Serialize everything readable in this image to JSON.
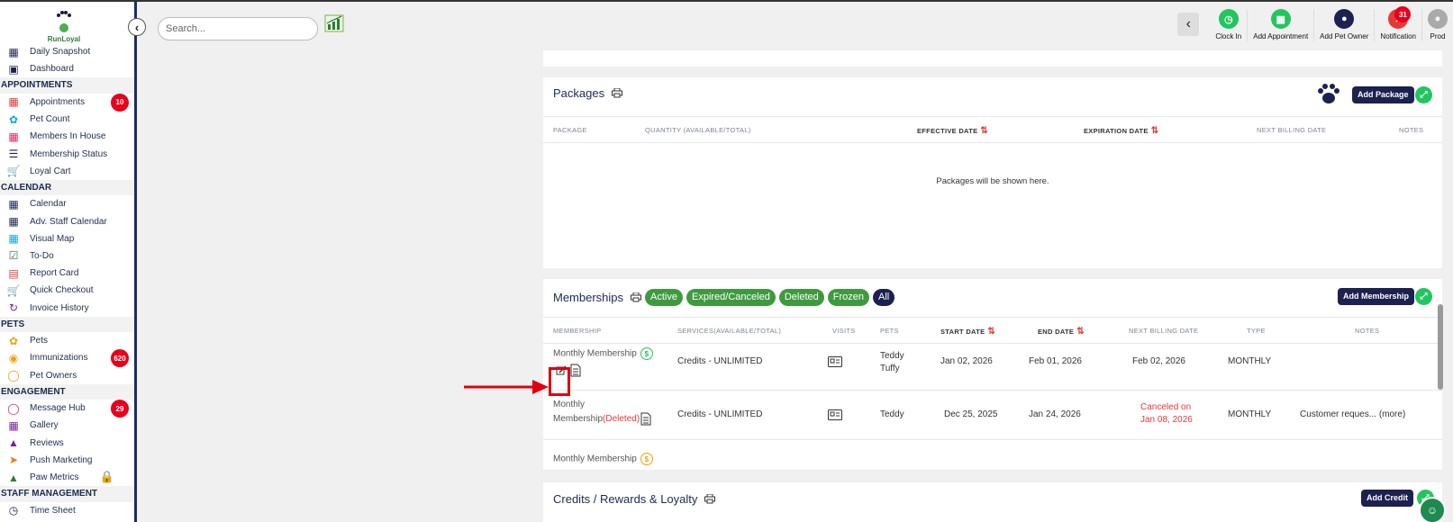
{
  "brand": {
    "name": "RunLoyal"
  },
  "search": {
    "placeholder": "Search..."
  },
  "sidebar": {
    "items_top": [
      {
        "label": "Daily Snapshot",
        "icon": "today-icon"
      },
      {
        "label": "Dashboard",
        "icon": "dashboard-icon"
      }
    ],
    "sections": [
      {
        "title": "APPOINTMENTS",
        "items": [
          {
            "label": "Appointments",
            "icon": "appointments-icon",
            "badge": "10"
          },
          {
            "label": "Pet Count",
            "icon": "pet-count-icon"
          },
          {
            "label": "Members In House",
            "icon": "house-icon"
          },
          {
            "label": "Membership Status",
            "icon": "status-icon"
          },
          {
            "label": "Loyal Cart",
            "icon": "cart-icon"
          }
        ]
      },
      {
        "title": "CALENDAR",
        "items": [
          {
            "label": "Calendar",
            "icon": "calendar-icon"
          },
          {
            "label": "Adv. Staff Calendar",
            "icon": "staff-calendar-icon"
          },
          {
            "label": "Visual Map",
            "icon": "map-icon"
          },
          {
            "label": "To-Do",
            "icon": "todo-icon"
          },
          {
            "label": "Report Card",
            "icon": "report-card-icon"
          },
          {
            "label": "Quick Checkout",
            "icon": "checkout-icon"
          },
          {
            "label": "Invoice History",
            "icon": "invoice-icon"
          }
        ]
      },
      {
        "title": "PETS",
        "items": [
          {
            "label": "Pets",
            "icon": "paw-icon"
          },
          {
            "label": "Immunizations",
            "icon": "immunization-icon",
            "badge": "620"
          },
          {
            "label": "Pet Owners",
            "icon": "person-icon"
          }
        ]
      },
      {
        "title": "ENGAGEMENT",
        "items": [
          {
            "label": "Message Hub",
            "icon": "message-icon",
            "badge": "29"
          },
          {
            "label": "Gallery",
            "icon": "gallery-icon"
          },
          {
            "label": "Reviews",
            "icon": "thumbs-up-icon"
          },
          {
            "label": "Push Marketing",
            "icon": "rocket-icon"
          },
          {
            "label": "Paw Metrics",
            "icon": "metrics-icon",
            "locked": true
          }
        ]
      },
      {
        "title": "STAFF MANAGEMENT",
        "items": [
          {
            "label": "Time Sheet",
            "icon": "clock-icon"
          }
        ]
      }
    ]
  },
  "topbar": {
    "items": [
      {
        "label": "Clock In",
        "color": "#22c55e"
      },
      {
        "label": "Add Appointment",
        "color": "#22c55e"
      },
      {
        "label": "Add Pet Owner",
        "color": "#1c2150"
      },
      {
        "label": "Notification",
        "color": "#e53935",
        "badge": "31"
      },
      {
        "label": "Prod",
        "color": "#aaaaaa"
      }
    ]
  },
  "packages": {
    "title": "Packages",
    "add_button": "Add Package",
    "columns": [
      "PACKAGE",
      "QUANTITY (AVAILABLE/TOTAL)",
      "EFFECTIVE DATE",
      "EXPIRATION DATE",
      "NEXT BILLING DATE",
      "NOTES"
    ],
    "empty_message": "Packages will be shown here."
  },
  "memberships": {
    "title": "Memberships",
    "filters": [
      "Active",
      "Expired/Canceled",
      "Deleted",
      "Frozen",
      "All"
    ],
    "add_button": "Add Membership",
    "columns": [
      "MEMBERSHIP",
      "SERVICES(AVAILABLE/TOTAL)",
      "VISITS",
      "PETS",
      "START DATE",
      "END DATE",
      "NEXT BILLING DATE",
      "TYPE",
      "NOTES"
    ],
    "rows": [
      {
        "name": "Monthly Membership",
        "deleted_tag": "",
        "services": "Credits - UNLIMITED",
        "pets": [
          "Teddy",
          "Tuffy"
        ],
        "start": "Jan 02, 2026",
        "end": "Feb 01, 2026",
        "next_billing": "Feb 02, 2026",
        "type": "MONTHLY",
        "notes": ""
      },
      {
        "name_line1": "Monthly",
        "name_line2": "Membership",
        "deleted_tag": "(Deleted)",
        "services": "Credits - UNLIMITED",
        "pets": [
          "Teddy"
        ],
        "start": "Dec 25, 2025",
        "end": "Jan 24, 2026",
        "next_billing_line1": "Canceled on",
        "next_billing_line2": "Jan 08, 2026",
        "type": "MONTHLY",
        "notes": "Customer reques...",
        "more": "(more)"
      },
      {
        "name": "Monthly Membership"
      }
    ]
  },
  "credits": {
    "title": "Credits / Rewards & Loyalty",
    "add_button": "Add Credit"
  }
}
